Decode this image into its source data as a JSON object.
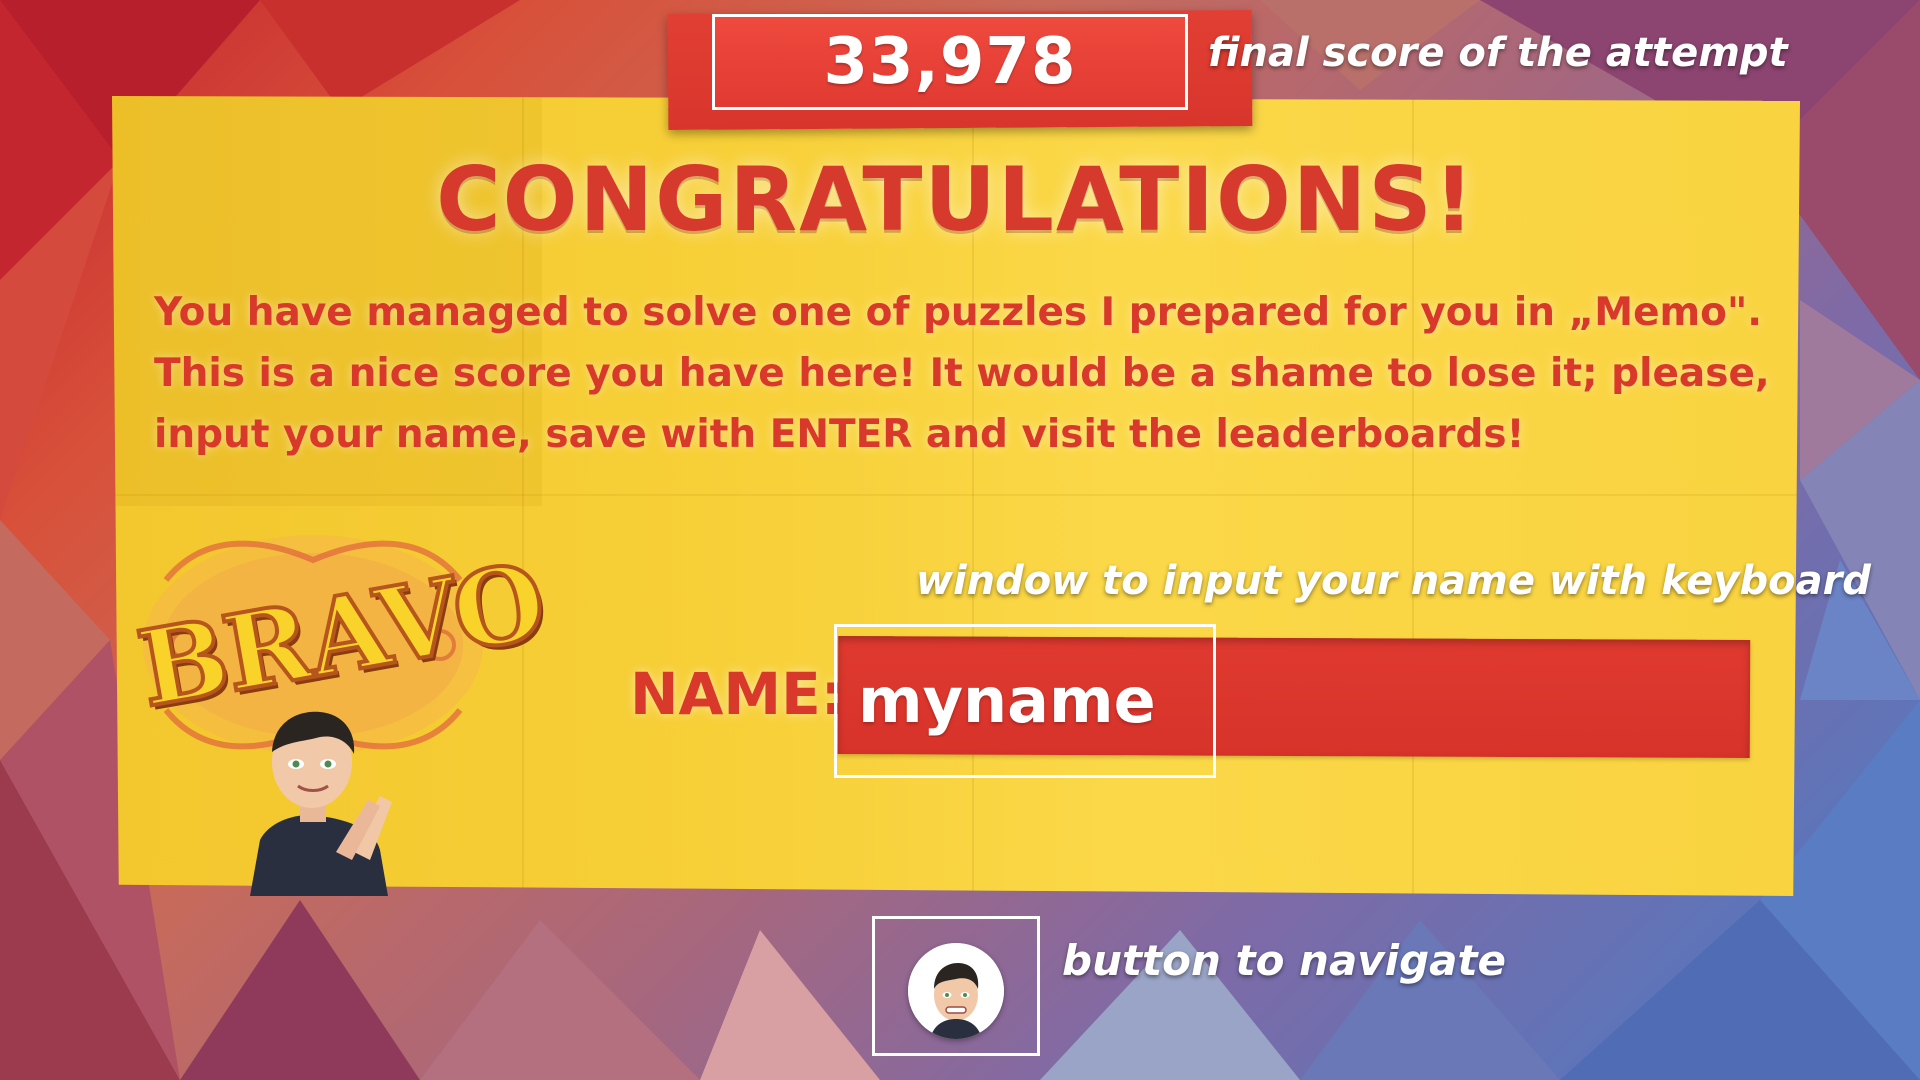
{
  "score": {
    "value": "33,978",
    "annotation": "final score of the attempt"
  },
  "title": "CONGRATULATIONS!",
  "message": {
    "lines": [
      "You have managed to solve one of puzzles I prepared for you in „Memo\".",
      "This is a nice score you have here! It would be a shame to lose it; please,",
      "input your name, save with ENTER and visit the leaderboards!"
    ]
  },
  "name_input": {
    "label": "NAME:",
    "value": "myname",
    "annotation": "window to input your name with keyboard"
  },
  "badge": {
    "text": "BRAVO"
  },
  "nav_button": {
    "icon": "avatar-icon",
    "annotation": "button to navigate"
  },
  "colors": {
    "paper": "#f7cf37",
    "accent_red": "#d8392b",
    "ribbon_red": "#e23f34",
    "annotation_text": "#ffffff"
  }
}
